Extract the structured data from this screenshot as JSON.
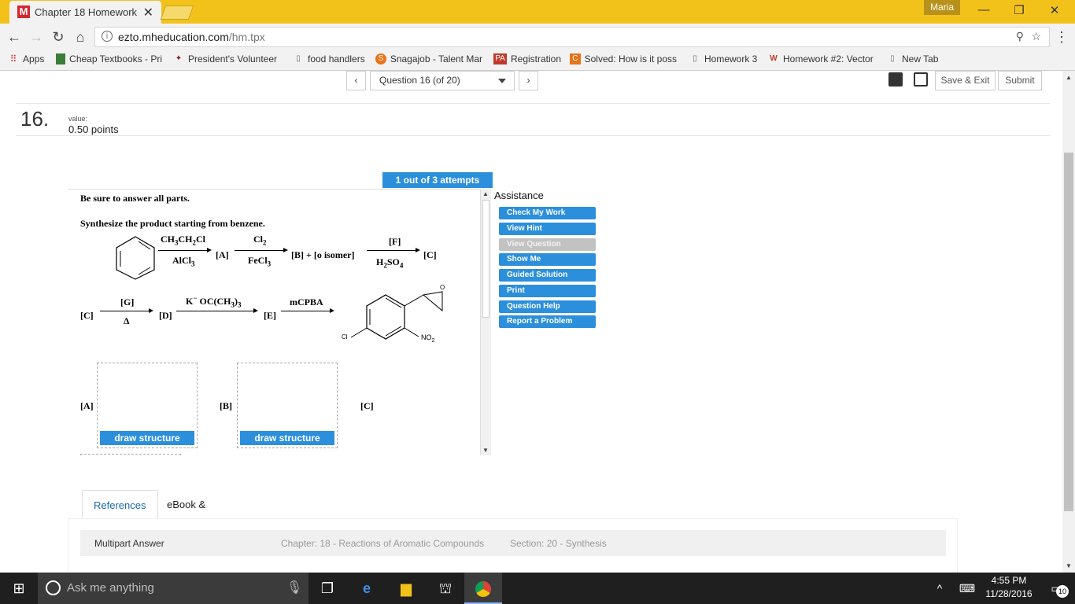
{
  "browser": {
    "tab_title": "Chapter 18 Homework",
    "tab_icon": "M",
    "user": "Maria",
    "url_host": "ezto.mheducation.com",
    "url_path": "/hm.tpx"
  },
  "bookmarks": [
    {
      "label": "Apps"
    },
    {
      "label": "Cheap Textbooks - Pri"
    },
    {
      "label": "President's Volunteer"
    },
    {
      "label": "food handlers"
    },
    {
      "label": "Snagajob - Talent Mar"
    },
    {
      "label": "Registration"
    },
    {
      "label": "Solved: How is it poss"
    },
    {
      "label": "Homework 3"
    },
    {
      "label": "Homework #2: Vector"
    },
    {
      "label": "New Tab"
    }
  ],
  "nav": {
    "question_select": "Question 16 (of 20)",
    "save_exit": "Save & Exit",
    "submit": "Submit"
  },
  "question": {
    "number": "16.",
    "value_label": "value:",
    "value_points": "0.50 points",
    "attempts": "1 out of 3 attempts",
    "line1": "Be sure to answer all parts.",
    "line2": "Synthesize the product starting from benzene."
  },
  "scheme": {
    "a": "[A]",
    "b": "[B] + [o  isomer]",
    "c": "[C]",
    "d": "[D]",
    "e": "[E]",
    "f": "[F]",
    "g": "[G]",
    "delta": "Δ",
    "mcpba": "mCPBA",
    "r1_top": "CH",
    "r1_sub1": "3",
    "r1_mid": "CH",
    "r1_sub2": "2",
    "r1_end": "Cl",
    "r1_bot": "AlCl",
    "r1_bot_sub": "3",
    "r2_top": "Cl",
    "r2_top_sub": "2",
    "r2_bot": "FeCl",
    "r2_bot_sub": "3",
    "r3_bot": "H",
    "r3_bot_sub1": "2",
    "r3_bot_mid": "SO",
    "r3_bot_sub2": "4",
    "r5_top": "K",
    "r5_sup": "−",
    "r5_mid": " OC(CH",
    "r5_sub": "3",
    "r5_end": ")",
    "r5_sub2": "3",
    "cl": "Cl",
    "no2": "NO",
    "no2_sub": "2",
    "o": "O"
  },
  "answers": [
    {
      "label": "[A]",
      "button": "draw structure"
    },
    {
      "label": "[B]",
      "button": "draw structure"
    },
    {
      "label": "[C]"
    }
  ],
  "assistance": {
    "title": "Assistance",
    "buttons": [
      {
        "label": "Check My Work",
        "enabled": true
      },
      {
        "label": "View Hint",
        "enabled": true
      },
      {
        "label": "View Question",
        "enabled": false
      },
      {
        "label": "Show Me",
        "enabled": true
      },
      {
        "label": "Guided Solution",
        "enabled": true
      },
      {
        "label": "Print",
        "enabled": true
      },
      {
        "label": "Question Help",
        "enabled": true
      },
      {
        "label": "Report a Problem",
        "enabled": true
      }
    ]
  },
  "references": {
    "tabs": [
      "References",
      "eBook & Resources"
    ],
    "row_title": "Multipart Answer",
    "chapter": "Chapter: 18 - Reactions of Aromatic Compounds",
    "section": "Section: 20 - Synthesis"
  },
  "taskbar": {
    "search_placeholder": "Ask me anything",
    "time": "4:55 PM",
    "date": "11/28/2016",
    "notifications": "10"
  },
  "colors": {
    "accent": "#2b8fdb",
    "titlebar": "#f2c21b"
  }
}
